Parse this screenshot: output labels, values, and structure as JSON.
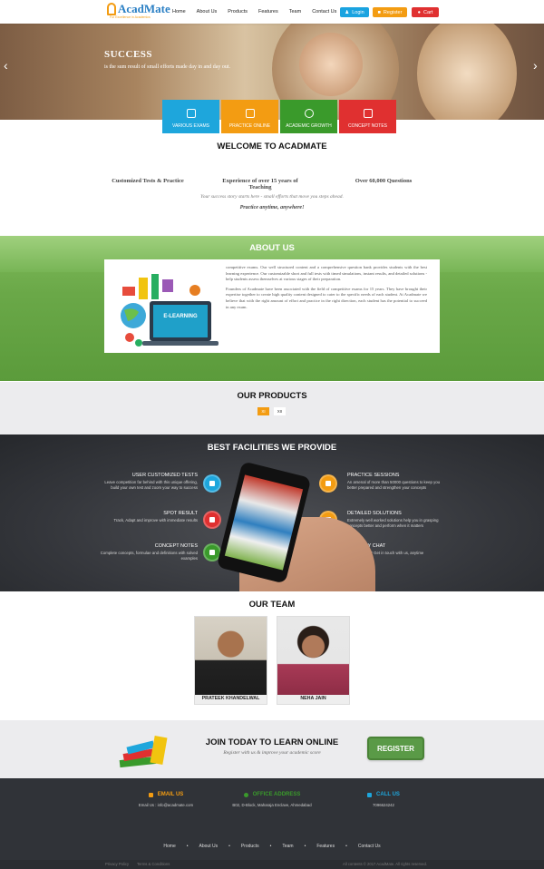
{
  "header": {
    "logo_text": "AcadMate",
    "logo_tagline": "For Excellence in Academics",
    "nav": [
      "Home",
      "About Us",
      "Products",
      "Features",
      "Team",
      "Contact Us"
    ],
    "login_label": "Login",
    "register_label": "Register",
    "cart_label": "Cart",
    "colors": {
      "login": "#1aa3e0",
      "register": "#f39c12",
      "cart": "#e03030"
    }
  },
  "hero": {
    "title": "SUCCESS",
    "subtitle": "is the sum result of small efforts made day in and day out."
  },
  "tiles": [
    {
      "label": "VARIOUS EXAMS",
      "color": "#1ea6dc",
      "icon": "list-icon"
    },
    {
      "label": "PRACTICE ONLINE",
      "color": "#f39c12",
      "icon": "monitor-icon"
    },
    {
      "label": "ACADEMIC GROWTH",
      "color": "#3a9a2b",
      "icon": "chart-icon"
    },
    {
      "label": "CONCEPT NOTES",
      "color": "#e03030",
      "icon": "document-icon"
    }
  ],
  "welcome": {
    "title": "WELCOME TO ACADMATE",
    "features": [
      "Customized Tests & Practice",
      "Experience of over 15 years of Teaching",
      "Over 60,000 Questions"
    ],
    "tagline": "Your success story starts here - small efforts that move you steps ahead.",
    "tagline2": "Practice anytime, anywhere!"
  },
  "about": {
    "title": "ABOUT US",
    "image_text": "E-LEARNING",
    "para1": "competitive exams. Our well structured content and a comprehensive question bank provides students with the best learning experience. Our customizable short and full tests with timed simulations, instant results, and detailed solutions - help students assess themselves at various stages of their preparation.",
    "para2": "Founders of Acadmate have been associated with the field of competitive exams for 15 years. They have brought their expertise together to create high quality content designed to cater to the specific needs of each student. At Acadmate we believe that with the right amount of effort and practice in the right direction, each student has the potential to succeed in any exam."
  },
  "products": {
    "title": "OUR PRODUCTS",
    "tabs": [
      "XI",
      "XII"
    ]
  },
  "facilities": {
    "title": "BEST FACILITIES WE PROVIDE",
    "left": [
      {
        "title": "USER CUSTOMIZED TESTS",
        "desc": "Leave competition far behind with this unique offering, build your own test and zoom your way to success",
        "color": "#1ea6dc"
      },
      {
        "title": "SPOT RESULT",
        "desc": "Track, Adapt and improve with immediate results",
        "color": "#e03030"
      },
      {
        "title": "CONCEPT NOTES",
        "desc": "Complete concepts, formulae and definitions with solved examples",
        "color": "#3a9a2b"
      }
    ],
    "right": [
      {
        "title": "PRACTICE SESSIONS",
        "desc": "An arsenal of more than 50000 questions to keep you better prepared and strengthen your concepts",
        "color": "#f39c12"
      },
      {
        "title": "DETAILED SOLUTIONS",
        "desc": "Extremely well worked solutions help you in grasping concepts better and perform when it matters",
        "color": "#f39c12"
      },
      {
        "title": "TWO WAY CHAT",
        "desc": "Have a query? Get in touch with us, anytime",
        "color": "#1ea6dc"
      }
    ]
  },
  "team": {
    "title": "OUR TEAM",
    "members": [
      "PRATEEK KHANDELWAL",
      "NEHA JAIN"
    ]
  },
  "join": {
    "title": "JOIN TODAY TO LEARN ONLINE",
    "subtitle": "Register with us & improve your academic score",
    "button": "REGISTER"
  },
  "footer": {
    "email_title": "EMAIL US",
    "email_value": "Email Us : info@acadmate.com",
    "address_title": "OFFICE ADDRESS",
    "address_value": "B02, D-Block, Maharaja Enclave, Ahmedabad",
    "call_title": "CALL US",
    "call_value": "7096624242",
    "nav": [
      "Home",
      "About Us",
      "Products",
      "Team",
      "Features",
      "Contact Us"
    ],
    "links": [
      "Privacy Policy",
      "Terms & Conditions"
    ],
    "copyright": "All contents © 2017 AcadMate. All rights reserved.",
    "colors": {
      "email": "#f39c12",
      "address": "#3a9a2b",
      "call": "#1ea6dc"
    }
  }
}
